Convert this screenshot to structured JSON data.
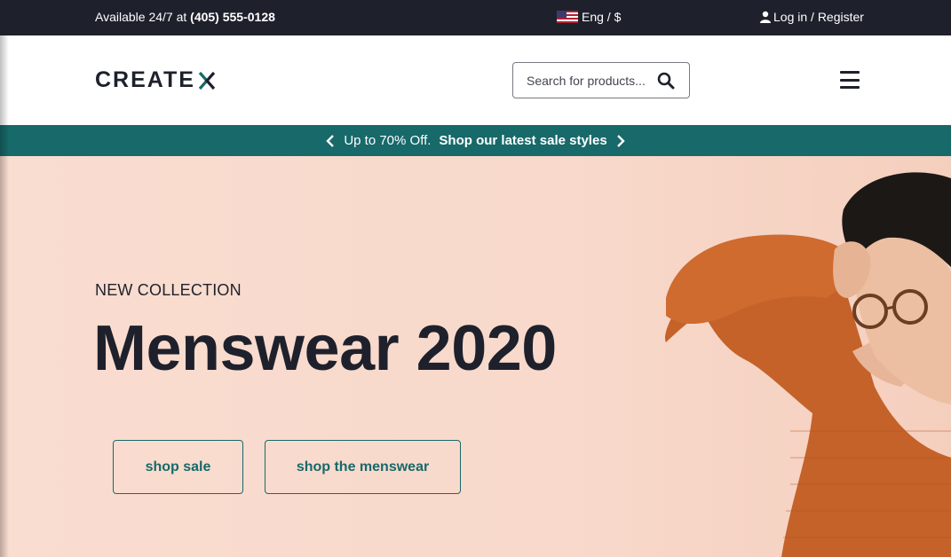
{
  "topbar": {
    "availability_text": "Available 24/7 at ",
    "phone": "(405) 555-0128",
    "language_currency": "Eng / $",
    "login_register": "Log in / Register"
  },
  "header": {
    "logo_text": "CREATE",
    "search_placeholder": "Search for products...",
    "icons": [
      "search-icon",
      "hamburger-menu-icon"
    ]
  },
  "promo": {
    "offer_text": "Up to 70% Off.",
    "link_text": "Shop our latest sale styles"
  },
  "hero": {
    "eyebrow": "NEW COLLECTION",
    "title": "Menswear 2020",
    "buttons": {
      "shop_sale": "shop sale",
      "shop_menswear": "shop the menswear"
    }
  },
  "colors": {
    "topbar_bg": "#1e212c",
    "accent": "#17696a",
    "hero_bg": "#f9ddd0",
    "text_dark": "#1e212c"
  }
}
